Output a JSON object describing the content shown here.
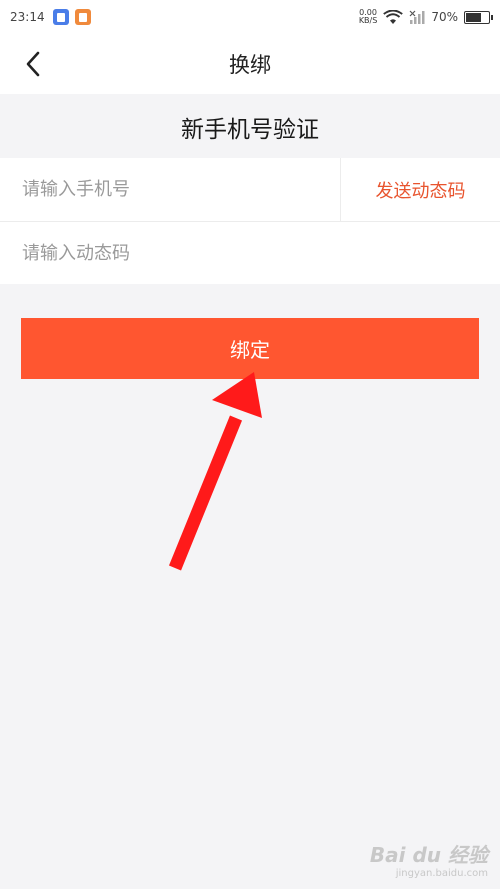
{
  "status": {
    "time": "23:14",
    "net_speed": "0.00",
    "net_unit": "KB/S",
    "battery": "70%",
    "battery_level": 0.7
  },
  "nav": {
    "title": "换绑",
    "back_icon": "chevron-left-icon"
  },
  "section": {
    "title": "新手机号验证"
  },
  "form": {
    "phone_placeholder": "请输入手机号",
    "phone_value": "",
    "send_code_label": "发送动态码",
    "code_placeholder": "请输入动态码",
    "code_value": ""
  },
  "actions": {
    "bind_label": "绑定"
  },
  "colors": {
    "accent": "#ff5630",
    "accent_text": "#e8542e",
    "annotation_arrow": "#ff1a1a"
  },
  "watermark": {
    "main": "Bai du 经验",
    "sub": "jingyan.baidu.com"
  }
}
